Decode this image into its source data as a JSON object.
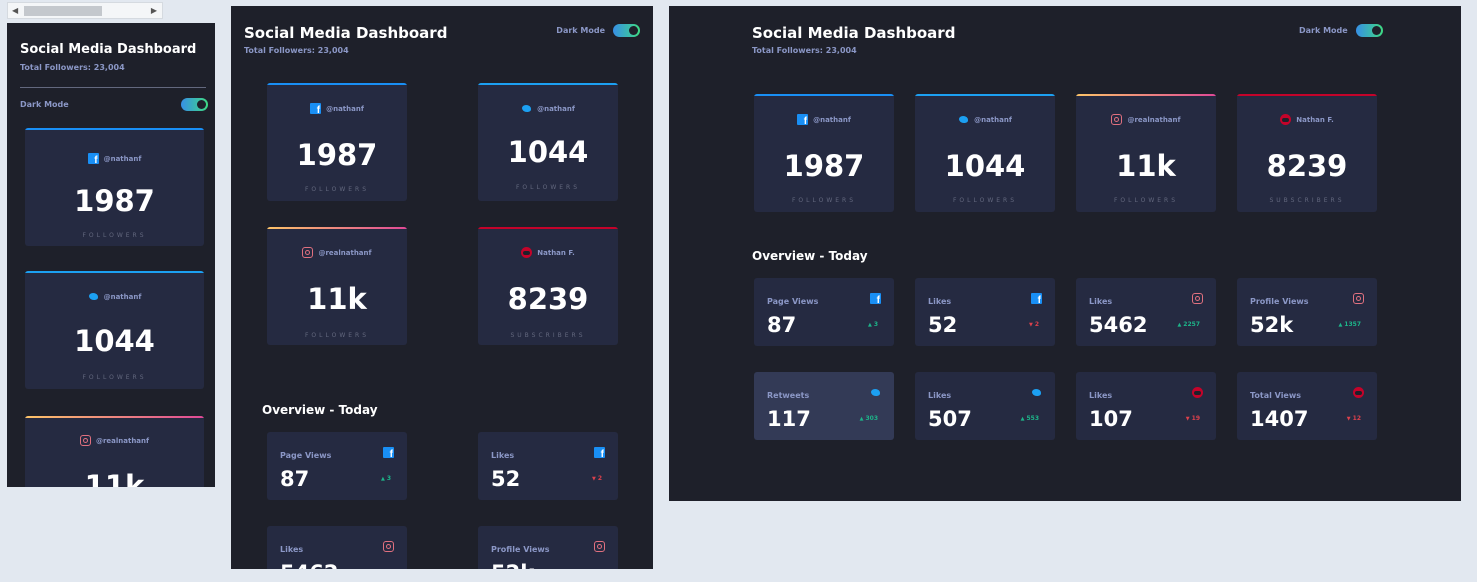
{
  "app": {
    "title": "Social Media Dashboard",
    "total_followers": "Total Followers: 23,004",
    "dark_mode_label": "Dark Mode",
    "overview_title": "Overview - Today"
  },
  "colors": {
    "background": "#1e202a",
    "card": "#252a41",
    "facebook": "#198ff5",
    "twitter": "#1ca0f2",
    "instagram_start": "#fdc468",
    "instagram_end": "#df4996",
    "youtube": "#c4032a",
    "up": "#1db489",
    "down": "#dc414c"
  },
  "followers": [
    {
      "network": "facebook",
      "icon": "facebook-icon",
      "handle": "@nathanf",
      "count": "1987",
      "label": "FOLLOWERS"
    },
    {
      "network": "twitter",
      "icon": "twitter-icon",
      "handle": "@nathanf",
      "count": "1044",
      "label": "FOLLOWERS"
    },
    {
      "network": "instagram",
      "icon": "instagram-icon",
      "handle": "@realnathanf",
      "count": "11k",
      "label": "FOLLOWERS"
    },
    {
      "network": "youtube",
      "icon": "youtube-icon",
      "handle": "Nathan F.",
      "count": "8239",
      "label": "SUBSCRIBERS"
    }
  ],
  "overview": [
    {
      "label": "Page Views",
      "icon": "facebook-icon",
      "value": "87",
      "change": "3",
      "direction": "up"
    },
    {
      "label": "Likes",
      "icon": "facebook-icon",
      "value": "52",
      "change": "2",
      "direction": "down"
    },
    {
      "label": "Likes",
      "icon": "instagram-icon",
      "value": "5462",
      "change": "2257",
      "direction": "up"
    },
    {
      "label": "Profile Views",
      "icon": "instagram-icon",
      "value": "52k",
      "change": "1357",
      "direction": "up"
    },
    {
      "label": "Retweets",
      "icon": "twitter-icon",
      "value": "117",
      "change": "303",
      "direction": "up"
    },
    {
      "label": "Likes",
      "icon": "twitter-icon",
      "value": "507",
      "change": "553",
      "direction": "up"
    },
    {
      "label": "Likes",
      "icon": "youtube-icon",
      "value": "107",
      "change": "19",
      "direction": "down"
    },
    {
      "label": "Total Views",
      "icon": "youtube-icon",
      "value": "1407",
      "change": "12",
      "direction": "down"
    }
  ],
  "tablet_partial_values": {
    "likes_cut": "5462",
    "profile_views_cut": "52k"
  }
}
